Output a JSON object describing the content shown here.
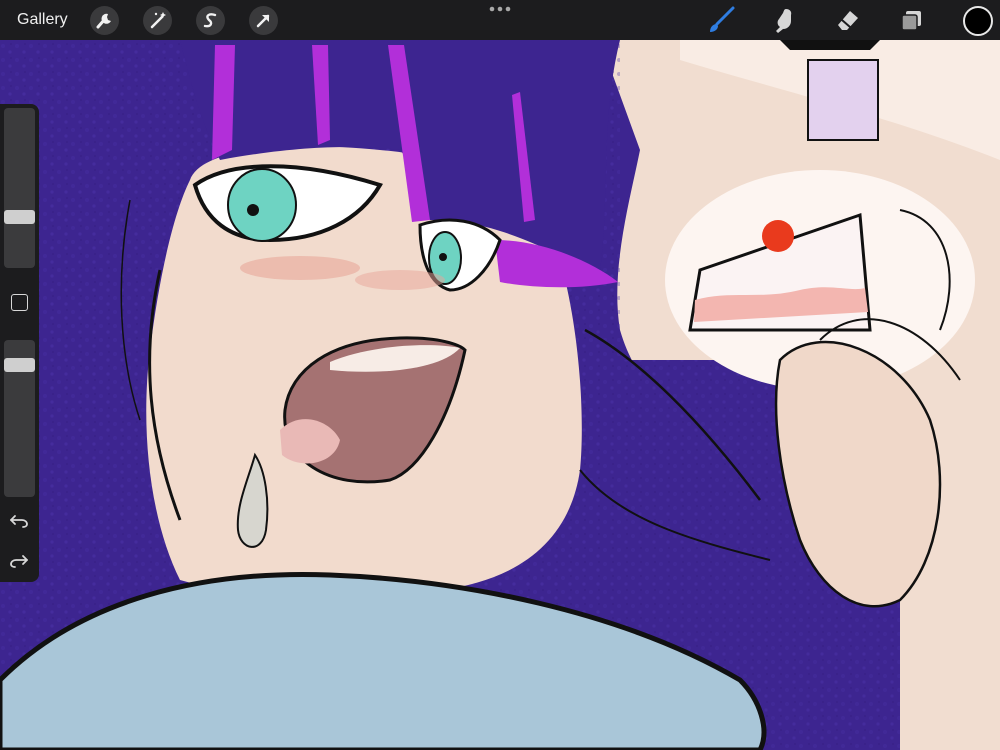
{
  "app": {
    "toolbar": {
      "gallery_label": "Gallery",
      "actions_icon": "wrench-icon",
      "adjustments_icon": "magic-wand-icon",
      "selection_icon": "selection-s-icon",
      "transform_icon": "arrow-cursor-icon",
      "more_icon": "ellipsis-icon",
      "brush_icon": "brush-icon",
      "smudge_icon": "smudge-finger-icon",
      "eraser_icon": "eraser-icon",
      "layers_icon": "layers-icon",
      "active_tool": "brush"
    },
    "sidebar": {
      "brush_size_level": 0.71,
      "opacity_level": 0.84,
      "modify_icon": "square-outline-icon",
      "undo_icon": "undo-icon",
      "redo_icon": "redo-icon"
    },
    "colors": {
      "toolbar_bg": "#1c1c1e",
      "active_accent": "#2f7de1",
      "current_color": "#000000",
      "hair": "#3d2590",
      "hair_highlight": "#b22fd9",
      "skin": "#f2dbcd",
      "eyes": "#6ed3c2",
      "clothing": "#a9c6d8",
      "background_cream": "#f4e4d8"
    }
  }
}
